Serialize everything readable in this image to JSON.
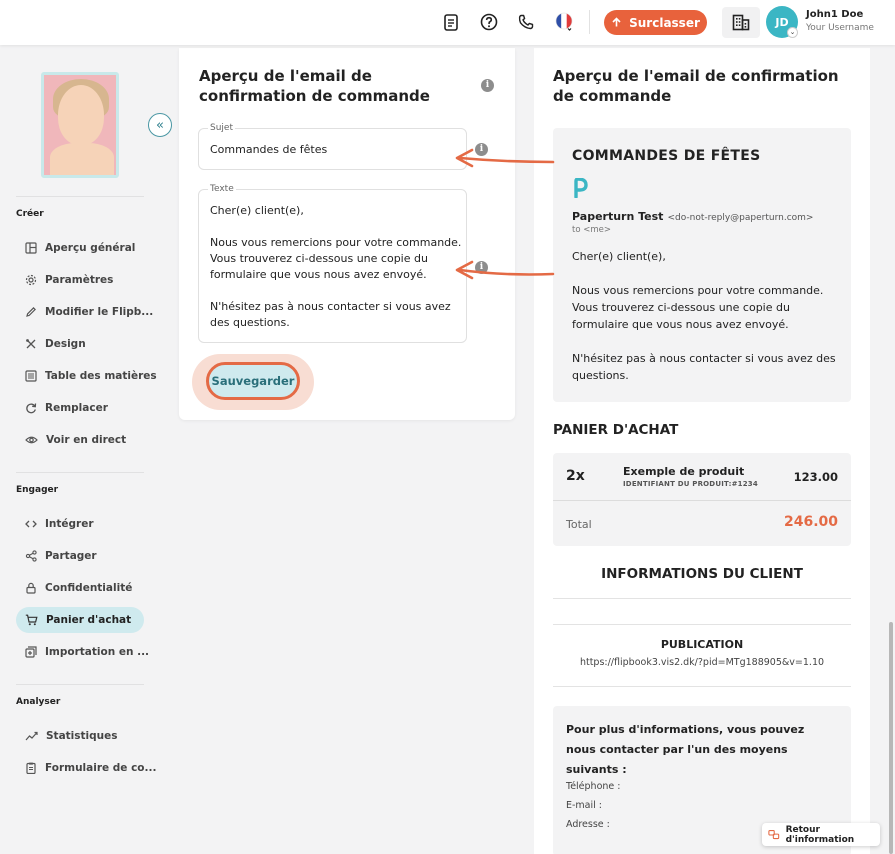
{
  "header": {
    "upgrade_label": "Surclasser",
    "user_name": "John1 Doe",
    "user_sub": "Your Username",
    "avatar_initials": "JD",
    "icons": [
      "document-icon",
      "help-icon",
      "phone-icon",
      "flag-fr-icon",
      "building-icon"
    ]
  },
  "sidebar": {
    "sections": [
      {
        "title": "Créer",
        "items": [
          {
            "label": "Aperçu général",
            "icon": "layout-icon"
          },
          {
            "label": "Paramètres",
            "icon": "gear-icon"
          },
          {
            "label": "Modifier le Flipb...",
            "icon": "pencil-icon"
          },
          {
            "label": "Design",
            "icon": "design-tools-icon"
          },
          {
            "label": "Table des matières",
            "icon": "toc-icon"
          },
          {
            "label": "Remplacer",
            "icon": "refresh-icon"
          },
          {
            "label": "Voir en direct",
            "icon": "eye-icon"
          }
        ]
      },
      {
        "title": "Engager",
        "items": [
          {
            "label": "Intégrer",
            "icon": "code-icon"
          },
          {
            "label": "Partager",
            "icon": "share-icon"
          },
          {
            "label": "Confidentialité",
            "icon": "lock-icon"
          },
          {
            "label": "Panier d'achat",
            "icon": "cart-icon",
            "active": true
          },
          {
            "label": "Importation en ...",
            "icon": "import-icon"
          }
        ]
      },
      {
        "title": "Analyser",
        "items": [
          {
            "label": "Statistiques",
            "icon": "chart-line-icon"
          },
          {
            "label": "Formulaire de co...",
            "icon": "clipboard-icon"
          }
        ]
      }
    ]
  },
  "editor": {
    "title": "Aperçu de l'email de confirmation de commande",
    "subject_label": "Sujet",
    "subject_value": "Commandes de fêtes",
    "text_label": "Texte",
    "text_value": "Cher(e) client(e),\n\nNous vous remercions pour votre commande. Vous trouverez ci-dessous une copie du formulaire que vous nous avez envoyé.\n\nN'hésitez pas à nous contacter si vous avez des questions.",
    "save_label": "Sauvegarder"
  },
  "preview": {
    "title": "Aperçu de l'email de confirmation de commande",
    "email_heading": "COMMANDES DE FÊTES",
    "sender_name": "Paperturn Test",
    "sender_address": "<do-not-reply@paperturn.com>",
    "to_line": "to <me>",
    "body": "Cher(e) client(e),\n\nNous vous remercions pour votre commande. Vous trouverez ci-dessous une copie du formulaire que vous nous avez envoyé.\n\nN'hésitez pas à nous contacter si vous avez des questions.",
    "cart_title": "PANIER D'ACHAT",
    "cart_item": {
      "qty": "2x",
      "name": "Exemple de produit",
      "id": "IDENTIFIANT DU PRODUIT:#1234",
      "price": "123.00"
    },
    "total_label": "Total",
    "total_value": "246.00",
    "client_title": "INFORMATIONS DU CLIENT",
    "publication_title": "PUBLICATION",
    "publication_url": "https://flipbook3.vis2.dk/?pid=MTg188905&v=1.10",
    "contact_lead": "Pour plus d'informations, vous pouvez nous contacter par l'un des moyens suivants :",
    "phone_label": "Téléphone :",
    "email_label": "E-mail :",
    "address_label": "Adresse :"
  },
  "feedback_label": "Retour d'information",
  "colors": {
    "accent": "#e8623c",
    "teal": "#3bb6c4",
    "active_bg": "#cfeaee"
  }
}
